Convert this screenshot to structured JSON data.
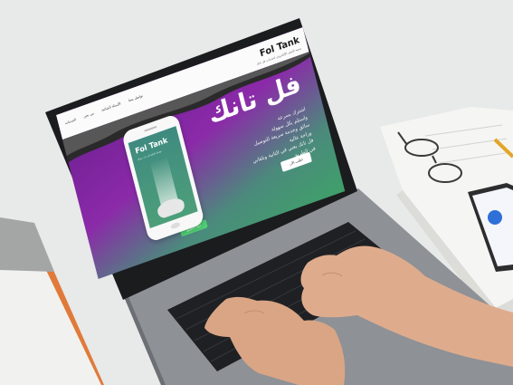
{
  "site": {
    "brand": "Fol Tank",
    "brand_sub": "منصة الحجز الإلكتروني لخدمات فل تانك",
    "nav": [
      "الخدمات",
      "من نحن",
      "الأسئلة الشائعة",
      "تواصل معنا"
    ]
  },
  "hero": {
    "title": "فل تانك",
    "lines": [
      "اشترك بسرعة",
      "واستلم بكل سهولة",
      "سائق وخدمة سريعة للتوصيل",
      "وراحة عالية",
      "فل تانك يعني في الثانية وتلقاني",
      "في الطريق"
    ],
    "cta": "اطلب الآن",
    "download": "حمل التطبيق"
  },
  "phone": {
    "logo": "Fol Tank",
    "tagline": "توصيل الوقود إلى باب منزلك"
  },
  "colors": {
    "purple": "#8b2aa9",
    "green": "#3fa06a",
    "laptop": "#8e9196"
  }
}
